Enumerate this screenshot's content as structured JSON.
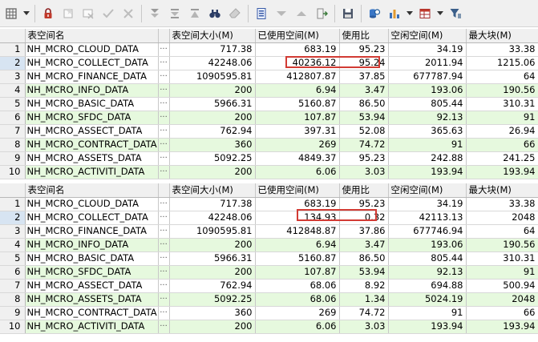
{
  "toolbar": {
    "icons": [
      "grid-settings-icon",
      "dropdown-arrow-icon",
      "lock-icon",
      "new-row-icon",
      "delete-row-icon",
      "post-edit-icon",
      "sort-desc-icon",
      "sort-asc-icon",
      "sort-icon",
      "find-icon",
      "clear-icon",
      "export-icon",
      "filter-down-icon",
      "filter-up-icon",
      "plugin-icon",
      "save-icon",
      "query-icon",
      "chart-icon",
      "chart-dropdown-icon",
      "table-icon",
      "table-dropdown-icon",
      "filter-icon"
    ]
  },
  "columns": [
    "表空间名",
    "",
    "表空间大小(M)",
    "已使用空间(M)",
    "使用比",
    "空闲空间(M)",
    "最大块(M)"
  ],
  "dots": "···",
  "grid1": {
    "rows": [
      {
        "n": "1",
        "name": "NH_MCRO_CLOUD_DATA",
        "size": "717.38",
        "used": "683.19",
        "ratio": "95.23",
        "free": "34.19",
        "max": "33.38"
      },
      {
        "n": "2",
        "name": "NH_MCRO_COLLECT_DATA",
        "size": "42248.06",
        "used": "40236.12",
        "ratio": "95.24",
        "free": "2011.94",
        "max": "1215.06"
      },
      {
        "n": "3",
        "name": "NH_MCRO_FINANCE_DATA",
        "size": "1090595.81",
        "used": "412807.87",
        "ratio": "37.85",
        "free": "677787.94",
        "max": "64"
      },
      {
        "n": "4",
        "name": "NH_MCRO_INFO_DATA",
        "size": "200",
        "used": "6.94",
        "ratio": "3.47",
        "free": "193.06",
        "max": "190.56"
      },
      {
        "n": "5",
        "name": "NH_MCRO_BASIC_DATA",
        "size": "5966.31",
        "used": "5160.87",
        "ratio": "86.50",
        "free": "805.44",
        "max": "310.31"
      },
      {
        "n": "6",
        "name": "NH_MCRO_SFDC_DATA",
        "size": "200",
        "used": "107.87",
        "ratio": "53.94",
        "free": "92.13",
        "max": "91"
      },
      {
        "n": "7",
        "name": "NH_MCRO_ASSECT_DATA",
        "size": "762.94",
        "used": "397.31",
        "ratio": "52.08",
        "free": "365.63",
        "max": "26.94"
      },
      {
        "n": "8",
        "name": "NH_MCRO_CONTRACT_DATA",
        "size": "360",
        "used": "269",
        "ratio": "74.72",
        "free": "91",
        "max": "66"
      },
      {
        "n": "9",
        "name": "NH_MCRO_ASSETS_DATA",
        "size": "5092.25",
        "used": "4849.37",
        "ratio": "95.23",
        "free": "242.88",
        "max": "241.25"
      },
      {
        "n": "10",
        "name": "NH_MCRO_ACTIVITI_DATA",
        "size": "200",
        "used": "6.06",
        "ratio": "3.03",
        "free": "193.94",
        "max": "193.94"
      }
    ]
  },
  "grid2": {
    "rows": [
      {
        "n": "1",
        "name": "NH_MCRO_CLOUD_DATA",
        "size": "717.38",
        "used": "683.19",
        "ratio": "95.23",
        "free": "34.19",
        "max": "33.38"
      },
      {
        "n": "2",
        "name": "NH_MCRO_COLLECT_DATA",
        "size": "42248.06",
        "used": "134.93",
        "ratio": "0.32",
        "free": "42113.13",
        "max": "2048"
      },
      {
        "n": "3",
        "name": "NH_MCRO_FINANCE_DATA",
        "size": "1090595.81",
        "used": "412848.87",
        "ratio": "37.86",
        "free": "677746.94",
        "max": "64"
      },
      {
        "n": "4",
        "name": "NH_MCRO_INFO_DATA",
        "size": "200",
        "used": "6.94",
        "ratio": "3.47",
        "free": "193.06",
        "max": "190.56"
      },
      {
        "n": "5",
        "name": "NH_MCRO_BASIC_DATA",
        "size": "5966.31",
        "used": "5160.87",
        "ratio": "86.50",
        "free": "805.44",
        "max": "310.31"
      },
      {
        "n": "6",
        "name": "NH_MCRO_SFDC_DATA",
        "size": "200",
        "used": "107.87",
        "ratio": "53.94",
        "free": "92.13",
        "max": "91"
      },
      {
        "n": "7",
        "name": "NH_MCRO_ASSECT_DATA",
        "size": "762.94",
        "used": "68.06",
        "ratio": "8.92",
        "free": "694.88",
        "max": "500.94"
      },
      {
        "n": "8",
        "name": "NH_MCRO_ASSETS_DATA",
        "size": "5092.25",
        "used": "68.06",
        "ratio": "1.34",
        "free": "5024.19",
        "max": "2048"
      },
      {
        "n": "9",
        "name": "NH_MCRO_CONTRACT_DATA",
        "size": "360",
        "used": "269",
        "ratio": "74.72",
        "free": "91",
        "max": "66"
      },
      {
        "n": "10",
        "name": "NH_MCRO_ACTIVITI_DATA",
        "size": "200",
        "used": "6.06",
        "ratio": "3.03",
        "free": "193.94",
        "max": "193.94"
      }
    ]
  },
  "colors": {
    "alt_row": "#e6f9de",
    "header": "#f0f0f0",
    "highlight": "#d23b34",
    "selected_rownum": "#d7e4f2"
  }
}
